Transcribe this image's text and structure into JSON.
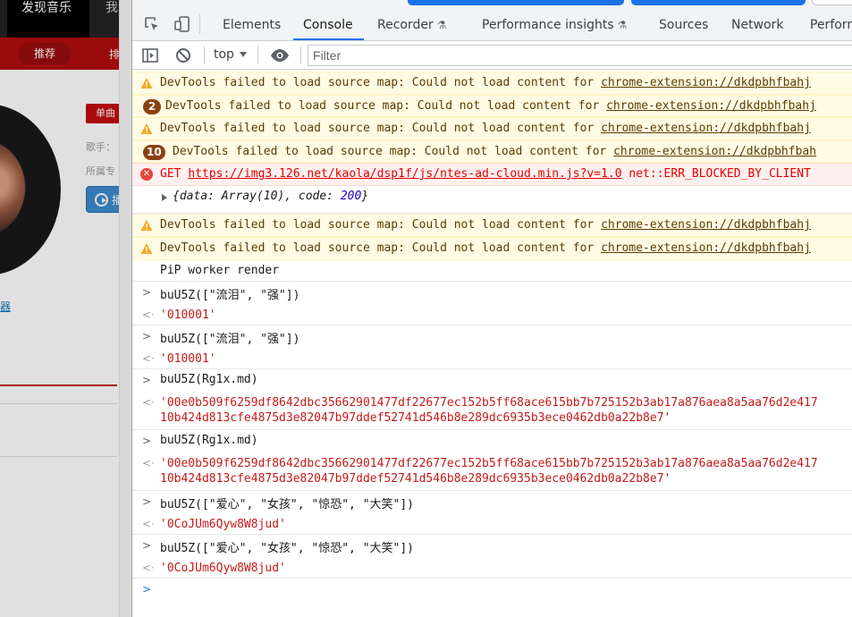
{
  "page": {
    "nav_active": "发现音乐",
    "nav_item": "我的音",
    "subnav_active": "推荐",
    "subnav_item": "排行",
    "tag": "单曲",
    "singer_label": "歌手：",
    "album_label": "所属专",
    "play_label": "播",
    "link_text": "器"
  },
  "devtools": {
    "tabs": [
      {
        "label": "Elements"
      },
      {
        "label": "Console"
      },
      {
        "label": "Recorder"
      },
      {
        "label": "Performance insights"
      },
      {
        "label": "Sources"
      },
      {
        "label": "Network"
      },
      {
        "label": "Perform"
      }
    ],
    "context": "top",
    "filter_placeholder": "Filter",
    "accent_color": "#1a73e8"
  },
  "console": {
    "warn_prefix": "DevTools failed to load source map: Could not load content for ",
    "warn_link": "chrome-extension://dkdpbhfbahj",
    "warn_link_short": "chrome-extension://dkdpbhfbah",
    "badge_2": "2",
    "badge_10": "10",
    "err_method": "GET ",
    "err_url": "https://img3.126.net/kaola/dsp1f/js/ntes-ad-cloud.min.js?v=1.0",
    "err_suffix": " net::ERR_BLOCKED_BY_CLIENT",
    "obj_prefix": "{data: Array(10), code: ",
    "obj_code": "200",
    "obj_suffix": "}",
    "pip_log": "PiP worker render",
    "cmd1": "buU5Z([\"流泪\", \"强\"])",
    "res1": "'010001'",
    "cmd2": "buU5Z([\"流泪\", \"强\"])",
    "res2": "'010001'",
    "cmd3": "buU5Z(Rg1x.md)",
    "res3": "'00e0b509f6259df8642dbc35662901477df22677ec152b5ff68ace615bb7b725152b3ab17a876aea8a5aa76d2e417\n10b424d813cfe4875d3e82047b97ddef52741d546b8e289dc6935b3ece0462db0a22b8e7'",
    "cmd4": "buU5Z(Rg1x.md)",
    "res4": "'00e0b509f6259df8642dbc35662901477df22677ec152b5ff68ace615bb7b725152b3ab17a876aea8a5aa76d2e417\n10b424d813cfe4875d3e82047b97ddef52741d546b8e289dc6935b3ece0462db0a22b8e7'",
    "cmd5": "buU5Z([\"爱心\", \"女孩\", \"惊恐\", \"大笑\"])",
    "res5": "'0CoJUm6Qyw8W8jud'",
    "cmd6": "buU5Z([\"爱心\", \"女孩\", \"惊恐\", \"大笑\"])",
    "res6": "'0CoJUm6Qyw8W8jud'"
  }
}
